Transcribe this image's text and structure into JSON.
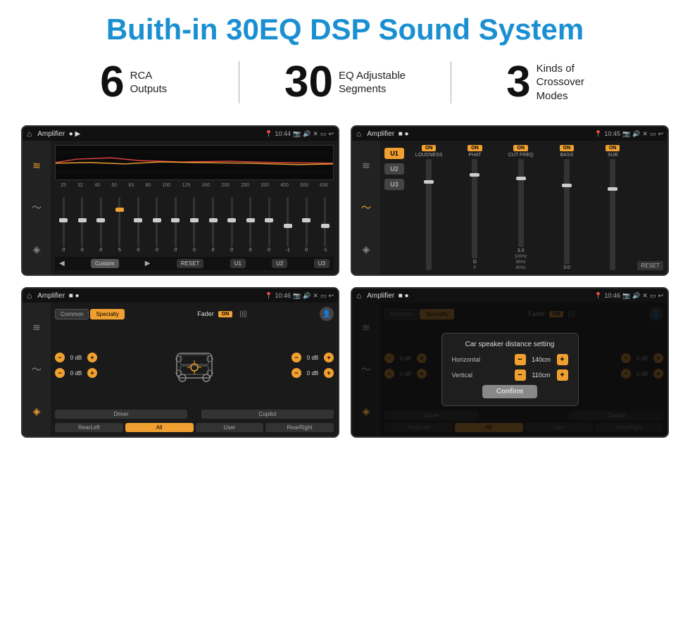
{
  "page": {
    "title": "Buith-in 30EQ DSP Sound System"
  },
  "stats": [
    {
      "number": "6",
      "label": "RCA\nOutputs"
    },
    {
      "number": "30",
      "label": "EQ Adjustable\nSegments"
    },
    {
      "number": "3",
      "label": "Kinds of\nCrossover Modes"
    }
  ],
  "screen1": {
    "title": "Amplifier",
    "time": "10:44",
    "eq_freqs": [
      "25",
      "32",
      "40",
      "50",
      "63",
      "80",
      "100",
      "125",
      "160",
      "200",
      "250",
      "320",
      "400",
      "500",
      "630"
    ],
    "eq_values": [
      "0",
      "0",
      "0",
      "5",
      "0",
      "0",
      "0",
      "0",
      "0",
      "0",
      "0",
      "0",
      "-1",
      "0",
      "-1"
    ],
    "bottom_btns": [
      "Custom",
      "RESET",
      "U1",
      "U2",
      "U3"
    ]
  },
  "screen2": {
    "title": "Amplifier",
    "time": "10:45",
    "u_buttons": [
      "U1",
      "U2",
      "U3"
    ],
    "controls": [
      {
        "label": "LOUDNESS",
        "on": true
      },
      {
        "label": "PHAT",
        "on": true
      },
      {
        "label": "CUT FREQ",
        "on": true
      },
      {
        "label": "BASS",
        "on": true
      },
      {
        "label": "SUB",
        "on": true
      }
    ],
    "reset_btn": "RESET"
  },
  "screen3": {
    "title": "Amplifier",
    "time": "10:46",
    "tabs": [
      "Common",
      "Specialty"
    ],
    "fader_label": "Fader",
    "fader_on": "ON",
    "db_rows": [
      {
        "left": "0 dB",
        "right": "0 dB"
      },
      {
        "left": "0 dB",
        "right": "0 dB"
      }
    ],
    "bottom_btns": [
      "Driver",
      "",
      "Copilot",
      "RearLeft",
      "All",
      "User",
      "RearRight"
    ]
  },
  "screen4": {
    "title": "Amplifier",
    "time": "10:46",
    "tabs": [
      "Common",
      "Specialty"
    ],
    "dialog": {
      "title": "Car speaker distance setting",
      "fields": [
        {
          "label": "Horizontal",
          "value": "140cm"
        },
        {
          "label": "Vertical",
          "value": "110cm"
        }
      ],
      "confirm_btn": "Confirm"
    },
    "db_rows": [
      {
        "right": "0 dB"
      },
      {
        "right": "0 dB"
      }
    ],
    "bottom_btns": [
      "Driver",
      "Copilot",
      "RearLeft",
      "All",
      "User",
      "RearRight"
    ]
  }
}
